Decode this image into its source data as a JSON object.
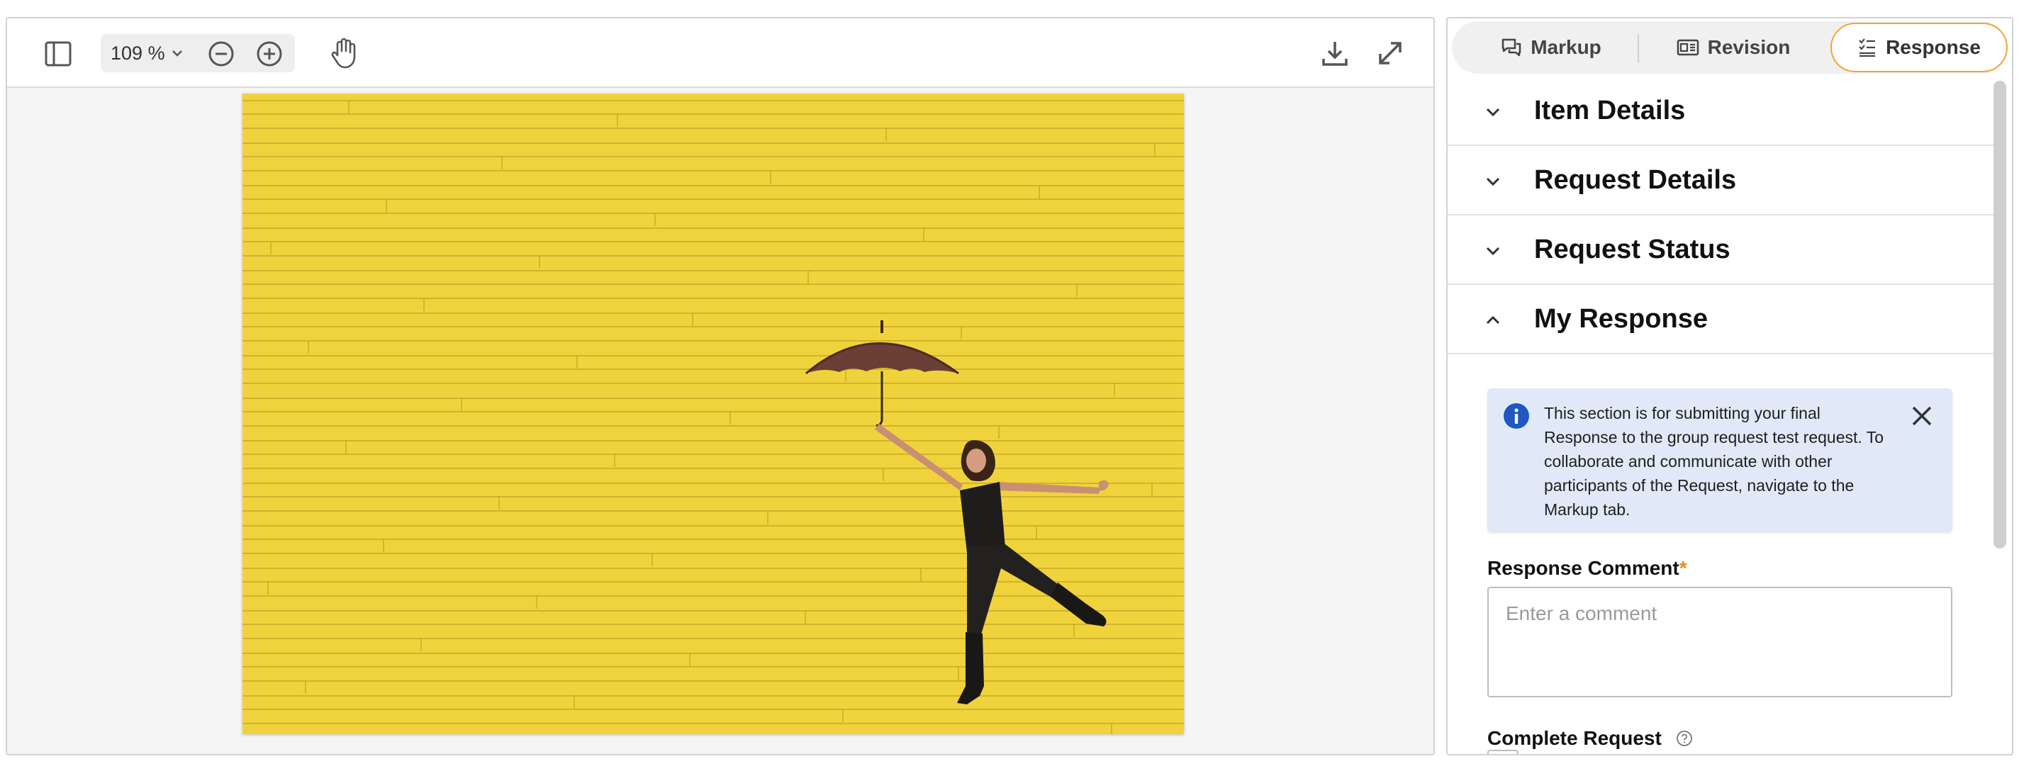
{
  "viewer": {
    "zoom_value": "109",
    "zoom_unit": "%",
    "image_alt": "Woman jumping with an umbrella in front of a yellow wooden wall"
  },
  "tabs": [
    {
      "label": "Markup",
      "icon": "comments-icon",
      "active": false
    },
    {
      "label": "Revision",
      "icon": "revision-icon",
      "active": false
    },
    {
      "label": "Response",
      "icon": "response-icon",
      "active": true
    }
  ],
  "sections": [
    {
      "title": "Item Details",
      "expanded": false
    },
    {
      "title": "Request Details",
      "expanded": false
    },
    {
      "title": "Request Status",
      "expanded": false
    },
    {
      "title": "My Response",
      "expanded": true
    }
  ],
  "info_notice": {
    "text": "This section is for submitting your final Response to the group request test request. To collaborate and communicate with other participants of the Request, navigate to the Markup tab."
  },
  "response_form": {
    "comment_label": "Response Comment",
    "required_marker": "*",
    "comment_placeholder": "Enter a comment",
    "complete_label": "Complete Request"
  },
  "colors": {
    "accent": "#f2a33a",
    "info_bg": "#e1e9f8",
    "info_icon": "#1f57c3",
    "wall_yellow": "#f0d33c"
  }
}
